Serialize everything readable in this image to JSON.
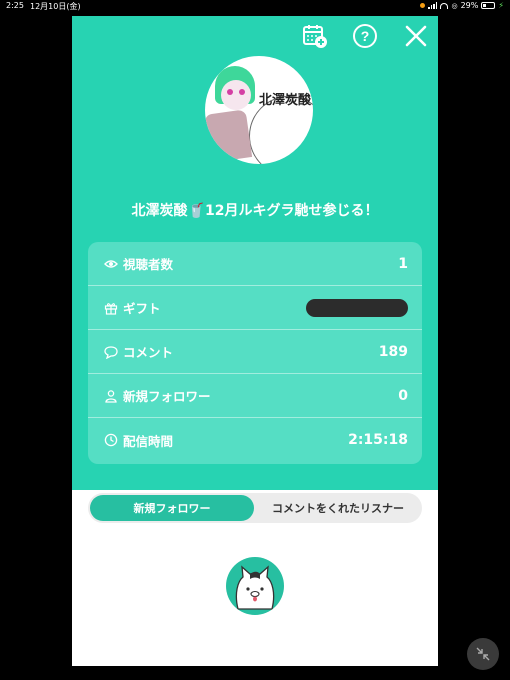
{
  "status_bar": {
    "time": "2:25",
    "date": "12月10日(金)",
    "battery": "29%"
  },
  "header_icons": [
    "calendar-plus-icon",
    "help-icon",
    "close-icon"
  ],
  "profile": {
    "avatar_text": "北澤炭酸",
    "title": "北澤炭酸🥤12月ルキグラ馳せ参じる！"
  },
  "stats": {
    "viewers": {
      "label": "視聴者数",
      "value": "1"
    },
    "gifts": {
      "label": "ギフト",
      "value": ""
    },
    "comments": {
      "label": "コメント",
      "value": "189"
    },
    "new_followers": {
      "label": "新規フォロワー",
      "value": "0"
    },
    "duration": {
      "label": "配信時間",
      "value": "2:15:18"
    }
  },
  "tabs": [
    {
      "label": "新規フォロワー",
      "active": true
    },
    {
      "label": "コメントをくれたリスナー",
      "active": false
    }
  ],
  "colors": {
    "accent": "#27d3b2",
    "card": "#55dec4",
    "tab_active": "#27bfa1"
  }
}
